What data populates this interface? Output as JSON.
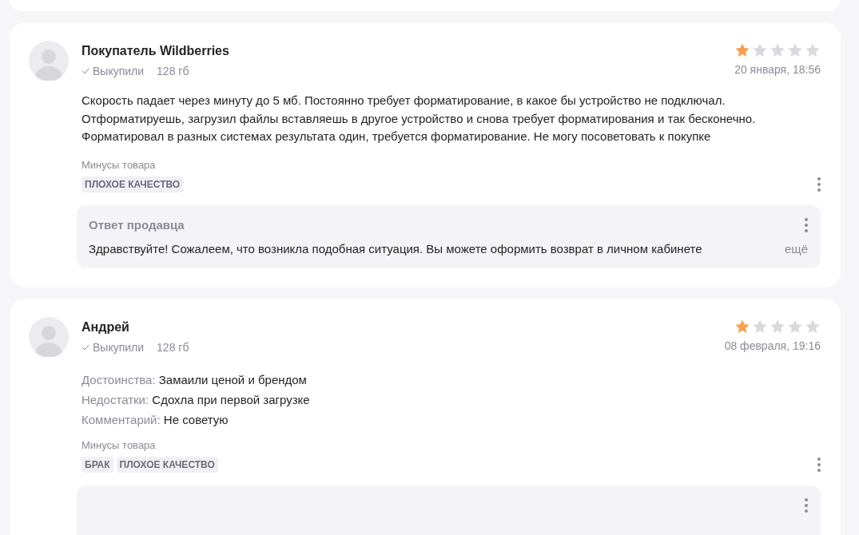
{
  "reviews": [
    {
      "author": "Покупатель Wildberries",
      "purchased": "Выкупили",
      "variant": "128 гб",
      "stars": 1,
      "date": "20 января, 18:56",
      "kind": "text",
      "text": "Скорость падает через минуту до 5 мб. Постоянно требует форматирование, в какое бы устройство не подключал. Отформатируешь, загрузил файлы вставляешь в другое устройство и снова требует форматирования и так бесконечно. Форматировал в разных системах результата один, требуется форматирование. Не могу посоветовать к покупке",
      "cons_label": "Минусы товара",
      "tags": [
        "ПЛОХОЕ КАЧЕСТВО"
      ],
      "reply": {
        "title": "Ответ продавца",
        "text": "Здравствуйте! Сожалеем, что возникла подобная ситуация. Вы можете оформить возврат в личном кабинете",
        "more": "ещё"
      }
    },
    {
      "author": "Андрей",
      "purchased": "Выкупили",
      "variant": "128 гб",
      "stars": 1,
      "date": "08 февраля, 19:16",
      "kind": "fields",
      "fields": [
        {
          "label": "Достоинства:",
          "value": "Замаили ценой и брендом"
        },
        {
          "label": "Недостатки:",
          "value": "Сдохла при первой загрузке"
        },
        {
          "label": "Комментарий:",
          "value": "Не советую"
        }
      ],
      "cons_label": "Минусы товара",
      "tags": [
        "БРАК",
        "ПЛОХОЕ КАЧЕСТВО"
      ],
      "has_reply": true
    }
  ]
}
